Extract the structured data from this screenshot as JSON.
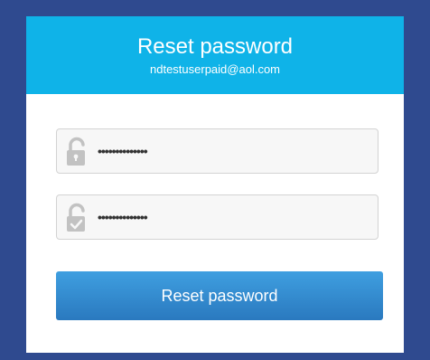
{
  "header": {
    "title": "Reset password",
    "email": "ndtestuserpaid@aol.com"
  },
  "form": {
    "password_field": {
      "icon": "lock-open-icon",
      "value": "••••••••••••••"
    },
    "confirm_field": {
      "icon": "lock-check-icon",
      "value": "••••••••••••••"
    },
    "submit_label": "Reset password"
  },
  "colors": {
    "background": "#2f4a8f",
    "header": "#0fb3e8",
    "button": "#3a8fd6"
  }
}
